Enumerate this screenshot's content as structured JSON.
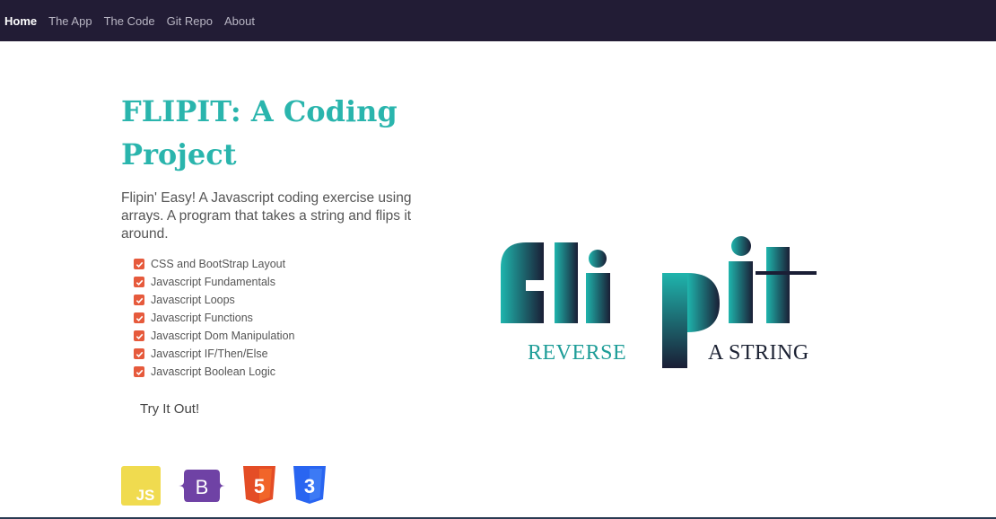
{
  "nav": {
    "items": [
      {
        "label": "Home",
        "active": true
      },
      {
        "label": "The App",
        "active": false
      },
      {
        "label": "The Code",
        "active": false
      },
      {
        "label": "Git Repo",
        "active": false
      },
      {
        "label": "About",
        "active": false
      }
    ]
  },
  "hero": {
    "title": "FLIPIT: A Coding Project",
    "description": "Flipin' Easy! A Javascript coding exercise using arrays. A program that takes a string and flips it around.",
    "features": [
      "CSS and BootStrap Layout",
      "Javascript Fundamentals",
      "Javascript Loops",
      "Javascript Functions",
      "Javascript Dom Manipulation",
      "Javascript IF/Then/Else",
      "Javascript Boolean Logic"
    ],
    "cta_label": "Try It Out!"
  },
  "tech_icons": [
    {
      "name": "js-icon",
      "label": "JS",
      "color": "#f0db4f"
    },
    {
      "name": "bootstrap-icon",
      "label": "B",
      "color": "#6f42a5"
    },
    {
      "name": "html5-icon",
      "label": "5",
      "color": "#e44d26"
    },
    {
      "name": "css3-icon",
      "label": "3",
      "color": "#2965f1"
    }
  ],
  "logo": {
    "word_left": "REVERSE",
    "word_right": "A STRING",
    "gradient_start": "#1fb5ad",
    "gradient_end": "#1a1e35"
  },
  "colors": {
    "navbar_bg": "#221c35",
    "title": "#2ab5ad",
    "check": "#e65a3c"
  }
}
